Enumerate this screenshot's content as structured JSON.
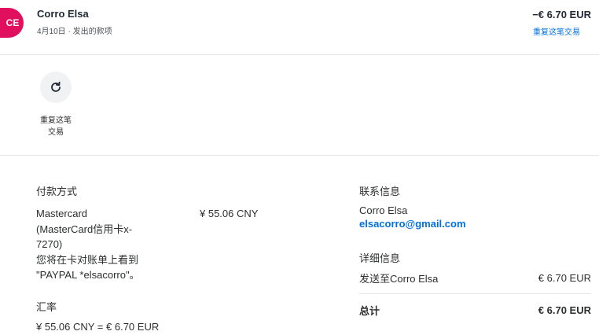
{
  "header": {
    "avatar_initials": "CE",
    "name": "Corro Elsa",
    "subline": "4月10日 · 发出的款项",
    "amount": "−€ 6.70 EUR",
    "repeat_link": "重复这笔交易"
  },
  "action": {
    "icon": "refresh-icon",
    "label_line1": "重复这笔",
    "label_line2": "交易"
  },
  "payment": {
    "title": "付款方式",
    "method_lines": [
      "Mastercard",
      "(MasterCard信用卡x-",
      "7270)",
      "您将在卡对账单上看到",
      "\"PAYPAL *elsacorro\"。"
    ],
    "amount": "¥ 55.06 CNY"
  },
  "exchange": {
    "title": "汇率",
    "value": "¥ 55.06 CNY = € 6.70 EUR"
  },
  "contact": {
    "title": "联系信息",
    "name": "Corro Elsa",
    "email": "elsacorro@gmail.com"
  },
  "details": {
    "title": "详细信息",
    "sent_to_label": "发送至Corro Elsa",
    "sent_to_amount": "€ 6.70 EUR",
    "total_label": "总计",
    "total_amount": "€ 6.70 EUR"
  },
  "colors": {
    "avatar_bg": "#e0105f",
    "link": "#0070e0"
  }
}
